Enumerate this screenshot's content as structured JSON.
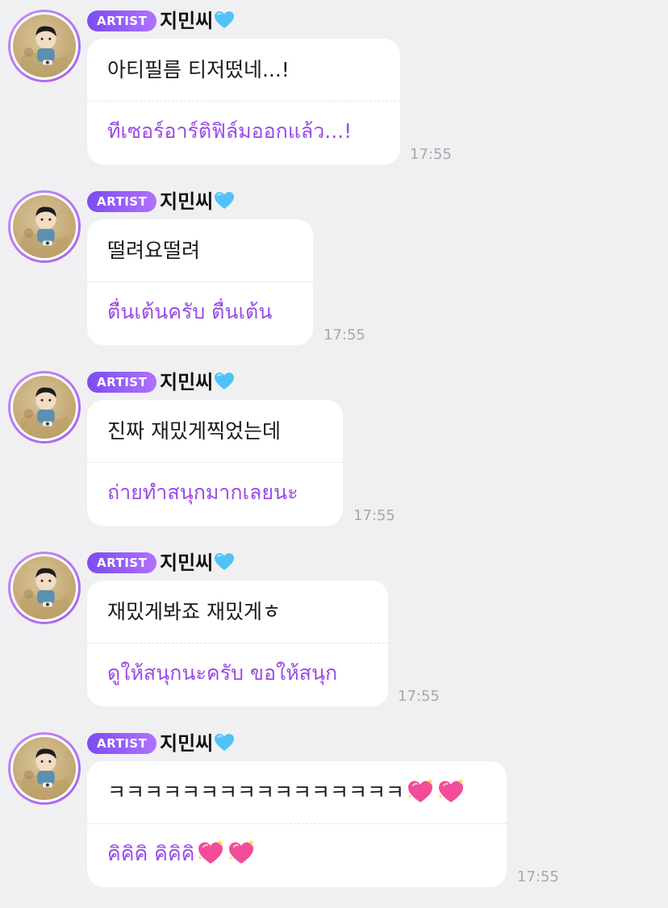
{
  "colors": {
    "background": "#f0f0f2",
    "badge_gradient": [
      "#7b4cf2",
      "#b071ff"
    ],
    "translation_text": "#9a4be6",
    "time_text": "#a8a8ac"
  },
  "messages": [
    {
      "badge": "ARTIST",
      "name": "지민씨",
      "name_icon": "blue-heart-icon",
      "original": "아티필름 티저떴네...!",
      "translation": "ทีเซอร์อาร์ติฟิล์มออกแล้ว...!",
      "time": "17:55"
    },
    {
      "badge": "ARTIST",
      "name": "지민씨",
      "name_icon": "blue-heart-icon",
      "original": "떨려요떨려",
      "translation": "ตื่นเต้นครับ ตื่นเต้น",
      "time": "17:55"
    },
    {
      "badge": "ARTIST",
      "name": "지민씨",
      "name_icon": "blue-heart-icon",
      "original": "진짜 재밌게찍었는데",
      "translation": "ถ่ายทำสนุกมากเลยนะ",
      "time": "17:55"
    },
    {
      "badge": "ARTIST",
      "name": "지민씨",
      "name_icon": "blue-heart-icon",
      "original": "재밌게봐죠 재밌게ㅎ",
      "translation": "ดูให้สนุกนะครับ ขอให้สนุก",
      "time": "17:55"
    },
    {
      "badge": "ARTIST",
      "name": "지민씨",
      "name_icon": "blue-heart-icon",
      "original": "ㅋㅋㅋㅋㅋㅋㅋㅋㅋㅋㅋㅋㅋㅋㅋㅋ",
      "original_icons": [
        "sparkling-heart-icon",
        "sparkling-heart-icon"
      ],
      "translation": "คิคิคิ คิคิคิ",
      "translation_icons": [
        "sparkling-heart-icon",
        "sparkling-heart-icon"
      ],
      "time": "17:55"
    }
  ]
}
